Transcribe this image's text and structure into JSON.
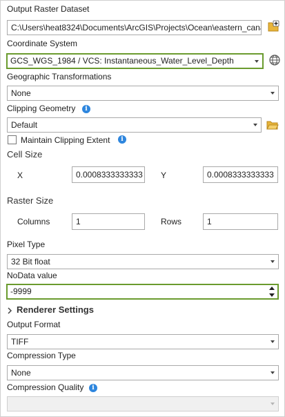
{
  "output_raster": {
    "label": "Output Raster Dataset",
    "value": "C:\\Users\\heat8324\\Documents\\ArcGIS\\Projects\\Ocean\\eastern_cana"
  },
  "coordinate_system": {
    "label": "Coordinate System",
    "value": "GCS_WGS_1984 / VCS: Instantaneous_Water_Level_Depth"
  },
  "geo_transformations": {
    "label": "Geographic Transformations",
    "value": "None"
  },
  "clipping": {
    "label": "Clipping Geometry",
    "value": "Default",
    "maintain_label": "Maintain Clipping Extent"
  },
  "cell_size": {
    "title": "Cell Size",
    "x_label": "X",
    "x_value": "0.0008333333333",
    "y_label": "Y",
    "y_value": "0.0008333333333"
  },
  "raster_size": {
    "title": "Raster Size",
    "columns_label": "Columns",
    "columns_value": "1",
    "rows_label": "Rows",
    "rows_value": "1"
  },
  "pixel_type": {
    "label": "Pixel Type",
    "value": "32 Bit float"
  },
  "nodata": {
    "label": "NoData value",
    "value": "-9999"
  },
  "renderer": {
    "label": "Renderer Settings"
  },
  "output_format": {
    "label": "Output Format",
    "value": "TIFF"
  },
  "compression_type": {
    "label": "Compression Type",
    "value": "None"
  },
  "compression_quality": {
    "label": "Compression Quality",
    "value": ""
  },
  "info_glyph": "i",
  "colors": {
    "accent_green": "#6a9b2e",
    "info_blue": "#2e86de",
    "folder_yellow": "#e8b53a"
  }
}
